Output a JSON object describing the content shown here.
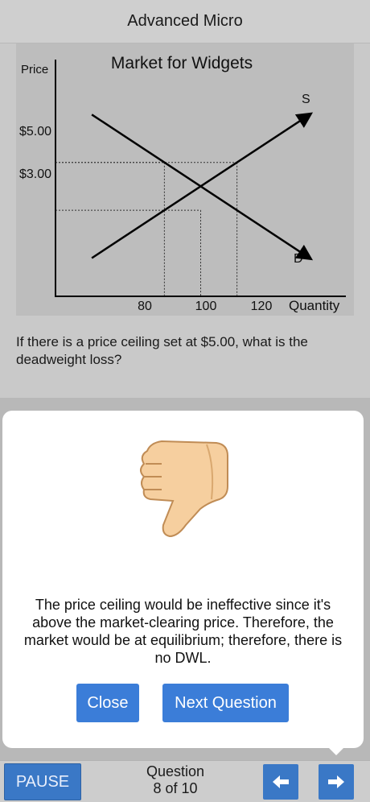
{
  "header": {
    "title": "Advanced Micro"
  },
  "chart_data": {
    "type": "line",
    "title": "Market for Widgets",
    "ylabel": "Price",
    "xlabel": "Quantity",
    "y_ticks": [
      "$5.00",
      "$3.00"
    ],
    "x_ticks": [
      "80",
      "100",
      "120"
    ],
    "series": [
      {
        "name": "S",
        "points": [
          [
            40,
            1
          ],
          [
            160,
            7
          ]
        ]
      },
      {
        "name": "D",
        "points": [
          [
            40,
            7
          ],
          [
            160,
            1
          ]
        ]
      }
    ],
    "reference_lines": [
      {
        "price": 5,
        "quantity": 80
      },
      {
        "price": 3,
        "quantity": 100
      },
      {
        "price": 5,
        "quantity": 120
      }
    ],
    "xlim": [
      20,
      180
    ],
    "ylim": [
      -0.6,
      9.3
    ]
  },
  "question": {
    "text": "If there is a price ceiling set at $5.00, what is the deadweight loss?"
  },
  "modal": {
    "feedback": "The price ceiling would be ineffective since it's above the market-clearing price. Therefore, the market would be at equilibrium; therefore, there is no DWL.",
    "close_label": "Close",
    "next_label": "Next Question",
    "icon": "thumbs-down-icon"
  },
  "footer": {
    "pause_label": "PAUSE",
    "progress_label": "Question",
    "progress_count": "8 of 10",
    "prev_icon": "arrow-left-icon",
    "next_icon": "arrow-right-icon"
  },
  "colors": {
    "button": "#3b7dd8",
    "footer_button": "#3a78c6",
    "modal_bg": "#ffffff",
    "graph_bg": "#bdbdbd"
  }
}
